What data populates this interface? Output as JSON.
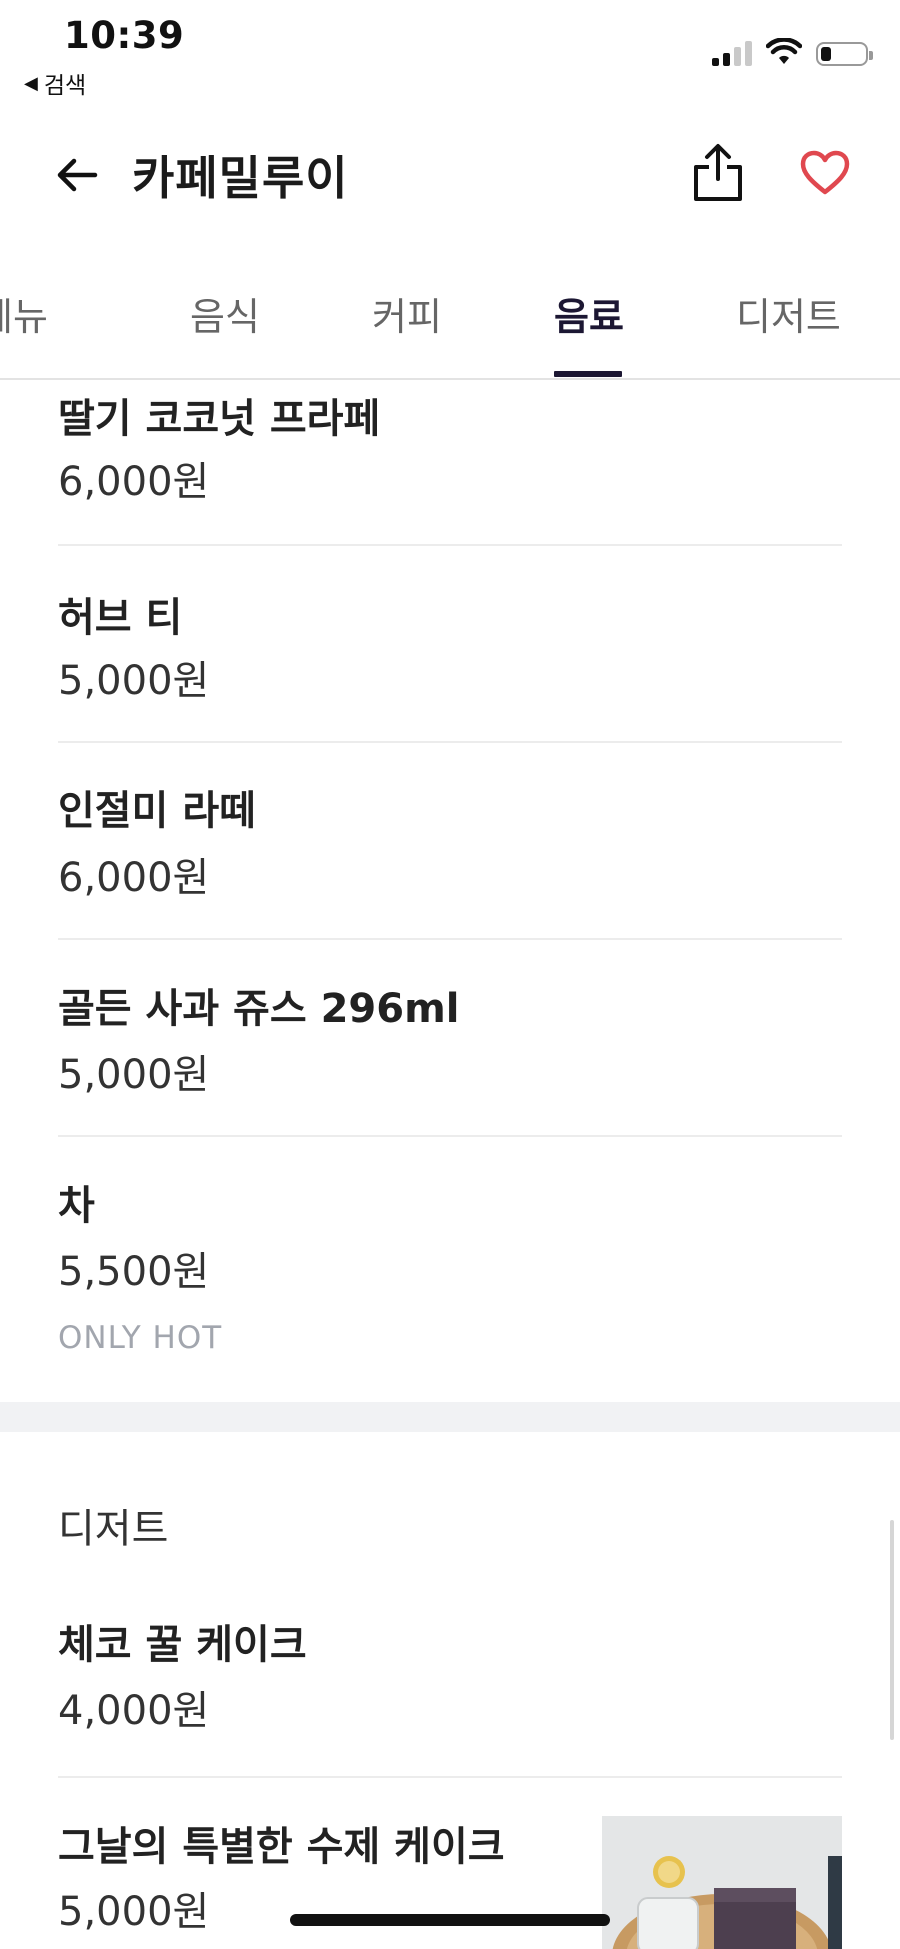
{
  "status_bar": {
    "time": "10:39",
    "back_label": "검색",
    "back_icon": "triangle-left-icon",
    "icons": [
      "signal-icon",
      "wifi-icon",
      "battery-icon"
    ]
  },
  "header": {
    "title": "카페밀루이",
    "back_icon": "arrow-left-icon",
    "share_icon": "share-icon",
    "favorite_icon": "heart-icon",
    "favorite_color": "#e0484f"
  },
  "tabs": [
    {
      "label": "메뉴",
      "partial": true
    },
    {
      "label": "음식"
    },
    {
      "label": "커피"
    },
    {
      "label": "음료",
      "active": true
    },
    {
      "label": "디저트"
    }
  ],
  "accent_color": "#1c1733",
  "drinks": [
    {
      "name": "딸기 코코넛 프라페",
      "price": "6,000원"
    },
    {
      "name": "허브 티",
      "price": "5,000원"
    },
    {
      "name": "인절미 라떼",
      "price": "6,000원"
    },
    {
      "name": "골든 사과 쥬스  296ml",
      "price": "5,000원"
    },
    {
      "name": "차",
      "price": "5,500원",
      "note": "ONLY HOT"
    }
  ],
  "dessert_section": {
    "title": "디저트",
    "items": [
      {
        "name": "체코 꿀 케이크",
        "price": "4,000원"
      },
      {
        "name": "그날의 특별한 수제 케이크",
        "price": "5,000원",
        "thumbnail": "cake-photo"
      }
    ]
  }
}
